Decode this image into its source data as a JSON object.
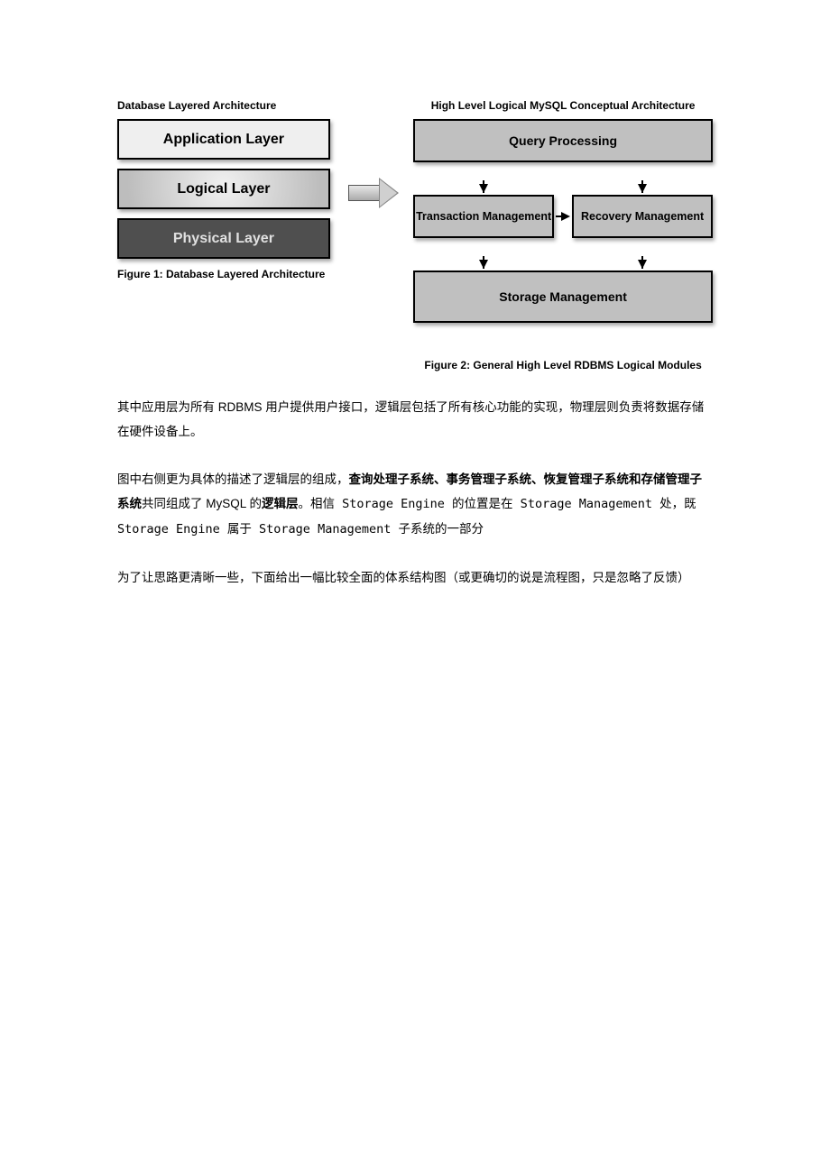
{
  "figure1": {
    "title": "Database Layered Architecture",
    "layers": [
      {
        "label": "Application Layer",
        "style": "app"
      },
      {
        "label": "Logical Layer",
        "style": "logical"
      },
      {
        "label": "Physical Layer",
        "style": "physical"
      }
    ],
    "caption": "Figure 1: Database Layered Architecture"
  },
  "figure2": {
    "title": "High Level Logical MySQL Conceptual Architecture",
    "query_box": "Query Processing",
    "tx_box": "Transaction Management",
    "recovery_box": "Recovery Management",
    "storage_box": "Storage Management",
    "caption": "Figure 2: General High Level RDBMS Logical Modules"
  },
  "paragraphs": {
    "p1": "其中应用层为所有 RDBMS 用户提供用户接口，逻辑层包括了所有核心功能的实现，物理层则负责将数据存储在硬件设备上。",
    "p2a": "图中右侧更为具体的描述了逻辑层的组成，",
    "p2b_bold": "查询处理子系统、事务管理子系统、恢复管理子系统和存储管理子系统",
    "p2c": "共同组成了 MySQL 的",
    "p2d_bold": "逻辑层",
    "p2e": "。相信 Storage Engine 的位置是在 Storage Management 处，既 Storage Engine 属于 Storage Management 子系统的一部分",
    "p3": "为了让思路更清晰一些，下面给出一幅比较全面的体系结构图（或更确切的说是流程图，只是忽略了反馈）"
  }
}
